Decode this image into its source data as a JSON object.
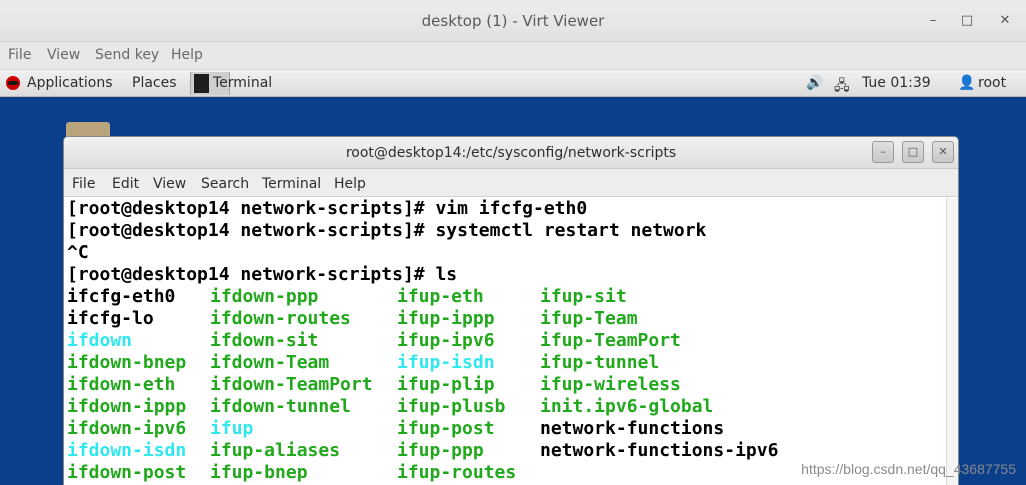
{
  "viewer": {
    "title": "desktop (1) - Virt Viewer",
    "controls": {
      "minimize": "–",
      "maximize": "□",
      "close": "✕"
    },
    "menu": [
      "File",
      "View",
      "Send key",
      "Help"
    ]
  },
  "topbar": {
    "applications": "Applications",
    "places": "Places",
    "task": "Terminal",
    "clock": "Tue 01:39",
    "user": "root",
    "icons": [
      "volume-icon",
      "network-icon",
      "user-icon"
    ]
  },
  "terminal": {
    "title": "root@desktop14:/etc/sysconfig/network-scripts",
    "controls": {
      "minimize": "–",
      "maximize": "□",
      "close": "✕"
    },
    "menu": [
      "File",
      "Edit",
      "View",
      "Search",
      "Terminal",
      "Help"
    ],
    "lines": [
      "[root@desktop14 network-scripts]# vim ifcfg-eth0",
      "[root@desktop14 network-scripts]# systemctl restart network",
      "^C",
      "[root@desktop14 network-scripts]# ls"
    ],
    "ls_columns": [
      [
        {
          "name": "ifcfg-eth0",
          "color": "#000000"
        },
        {
          "name": "ifcfg-lo",
          "color": "#000000"
        },
        {
          "name": "ifdown",
          "color": "#2ee8ee"
        },
        {
          "name": "ifdown-bnep",
          "color": "#22a81c"
        },
        {
          "name": "ifdown-eth",
          "color": "#22a81c"
        },
        {
          "name": "ifdown-ippp",
          "color": "#22a81c"
        },
        {
          "name": "ifdown-ipv6",
          "color": "#22a81c"
        },
        {
          "name": "ifdown-isdn",
          "color": "#2ee8ee"
        },
        {
          "name": "ifdown-post",
          "color": "#22a81c"
        }
      ],
      [
        {
          "name": "ifdown-ppp",
          "color": "#22a81c"
        },
        {
          "name": "ifdown-routes",
          "color": "#22a81c"
        },
        {
          "name": "ifdown-sit",
          "color": "#22a81c"
        },
        {
          "name": "ifdown-Team",
          "color": "#22a81c"
        },
        {
          "name": "ifdown-TeamPort",
          "color": "#22a81c"
        },
        {
          "name": "ifdown-tunnel",
          "color": "#22a81c"
        },
        {
          "name": "ifup",
          "color": "#2ee8ee"
        },
        {
          "name": "ifup-aliases",
          "color": "#22a81c"
        },
        {
          "name": "ifup-bnep",
          "color": "#22a81c"
        }
      ],
      [
        {
          "name": "ifup-eth",
          "color": "#22a81c"
        },
        {
          "name": "ifup-ippp",
          "color": "#22a81c"
        },
        {
          "name": "ifup-ipv6",
          "color": "#22a81c"
        },
        {
          "name": "ifup-isdn",
          "color": "#2ee8ee"
        },
        {
          "name": "ifup-plip",
          "color": "#22a81c"
        },
        {
          "name": "ifup-plusb",
          "color": "#22a81c"
        },
        {
          "name": "ifup-post",
          "color": "#22a81c"
        },
        {
          "name": "ifup-ppp",
          "color": "#22a81c"
        },
        {
          "name": "ifup-routes",
          "color": "#22a81c"
        }
      ],
      [
        {
          "name": "ifup-sit",
          "color": "#22a81c"
        },
        {
          "name": "ifup-Team",
          "color": "#22a81c"
        },
        {
          "name": "ifup-TeamPort",
          "color": "#22a81c"
        },
        {
          "name": "ifup-tunnel",
          "color": "#22a81c"
        },
        {
          "name": "ifup-wireless",
          "color": "#22a81c"
        },
        {
          "name": "init.ipv6-global",
          "color": "#22a81c"
        },
        {
          "name": "network-functions",
          "color": "#000000"
        },
        {
          "name": "network-functions-ipv6",
          "color": "#000000"
        }
      ]
    ]
  },
  "watermark": "https://blog.csdn.net/qq_43687755",
  "colors": {
    "desktop": "#0b3f8c",
    "exec_green": "#22a81c",
    "symlink_cyan": "#2ee8ee"
  }
}
